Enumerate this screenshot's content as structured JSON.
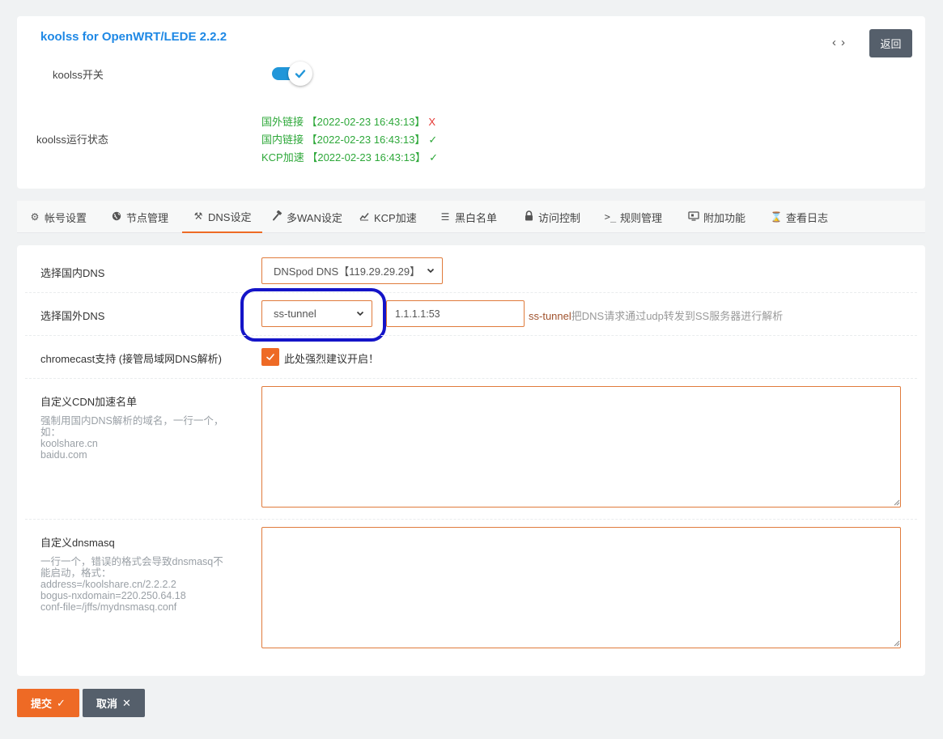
{
  "header": {
    "title": "koolss for OpenWRT/LEDE 2.2.2",
    "nav_prev": "‹",
    "nav_next": "›",
    "back_label": "返回"
  },
  "switch": {
    "label": "koolss开关",
    "state": "on"
  },
  "status": {
    "label": "koolss运行状态",
    "lines": [
      {
        "text": "国外链接 【2022-02-23 16:43:13】",
        "mark": "X"
      },
      {
        "text": "国内链接 【2022-02-23 16:43:13】",
        "mark": "✓"
      },
      {
        "text": "KCP加速 【2022-02-23 16:43:13】",
        "mark": "✓"
      }
    ]
  },
  "tabs": [
    {
      "label": "帐号设置",
      "icon": "gear-icon"
    },
    {
      "label": "节点管理",
      "icon": "globe-icon"
    },
    {
      "label": "DNS设定",
      "icon": "tools-icon"
    },
    {
      "label": "多WAN设定",
      "icon": "hammer-icon"
    },
    {
      "label": "KCP加速",
      "icon": "chart-icon"
    },
    {
      "label": "黑白名单",
      "icon": "list-icon"
    },
    {
      "label": "访问控制",
      "icon": "lock-icon"
    },
    {
      "label": "规则管理",
      "icon": "terminal-icon"
    },
    {
      "label": "附加功能",
      "icon": "monitor-icon"
    },
    {
      "label": "查看日志",
      "icon": "hourglass-icon"
    }
  ],
  "active_tab": "DNS设定",
  "form": {
    "china_dns": {
      "label": "选择国内DNS",
      "value": "DNSpod DNS【119.29.29.29】"
    },
    "foreign_dns": {
      "label": "选择国外DNS",
      "value": "ss-tunnel",
      "server": "1.1.1.1:53",
      "helper_highlight": "ss-tunnel",
      "helper_rest": "把DNS请求通过udp转发到SS服务器进行解析"
    },
    "chromecast": {
      "label": "chromecast支持 (接管局域网DNS解析)",
      "checked": true,
      "check_label": "此处强烈建议开启！"
    },
    "cdn_list": {
      "label": "自定义CDN加速名单",
      "hint": [
        "强制用国内DNS解析的域名，一行一个，",
        "如：",
        "koolshare.cn",
        "baidu.com"
      ],
      "value": ""
    },
    "dnsmasq": {
      "label": "自定义dnsmasq",
      "hint": [
        "一行一个，错误的格式会导致dnsmasq不",
        "能启动，格式：",
        "address=/koolshare.cn/2.2.2.2",
        "bogus-nxdomain=220.250.64.18",
        "conf-file=/jffs/mydnsmasq.conf"
      ],
      "value": ""
    }
  },
  "actions": {
    "submit_label": "提交",
    "submit_glyph": "✓",
    "cancel_label": "取消",
    "cancel_glyph": "✕"
  },
  "colors": {
    "accent": "#ee6a25",
    "title_blue": "#1e88e5",
    "status_green": "#2ea83a",
    "status_red": "#e53935",
    "highlight_ring": "#1414c8",
    "dark_button": "#555f6b"
  }
}
